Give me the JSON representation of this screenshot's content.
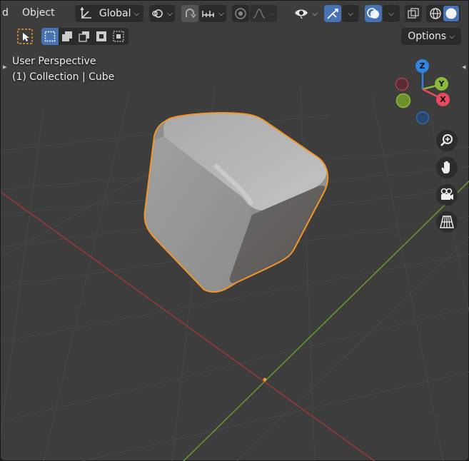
{
  "header": {
    "cut_label": "d",
    "object_menu": "Object",
    "transform_orientation": "Global"
  },
  "overlay": {
    "view_name": "User Perspective",
    "collection_line": "(1) Collection | Cube"
  },
  "options": {
    "label": "Options"
  },
  "gizmo": {
    "z": "Z",
    "y": "Y",
    "x": "X"
  },
  "icons": {
    "transform": "transform-axes-icon",
    "pivot": "pivot-point-icon",
    "snap": "snap-magnet-icon",
    "snap_target": "snap-increment-icon",
    "proportional": "proportional-edit-icon",
    "falloff": "falloff-curve-icon",
    "visibility": "eye-visibility-icon",
    "gizmos": "gizmo-icon",
    "overlays": "overlays-icon",
    "xray": "xray-icon",
    "wireframe_shading": "wireframe-shading-icon",
    "solid_shading": "solid-shading-icon",
    "zoom": "zoom-icon",
    "pan": "hand-pan-icon",
    "camera": "camera-icon",
    "ortho": "ortho-grid-icon"
  },
  "colors": {
    "viewport_bg": "#3d3d3d",
    "selection_outline": "#f0962b",
    "x_axis_line": "#9b3838",
    "y_axis_line": "#6a9a2e",
    "active_blue": "#4772b3",
    "gizmo_x": "#e84a5f",
    "gizmo_y": "#8bb93a",
    "gizmo_z": "#2f85e0"
  }
}
